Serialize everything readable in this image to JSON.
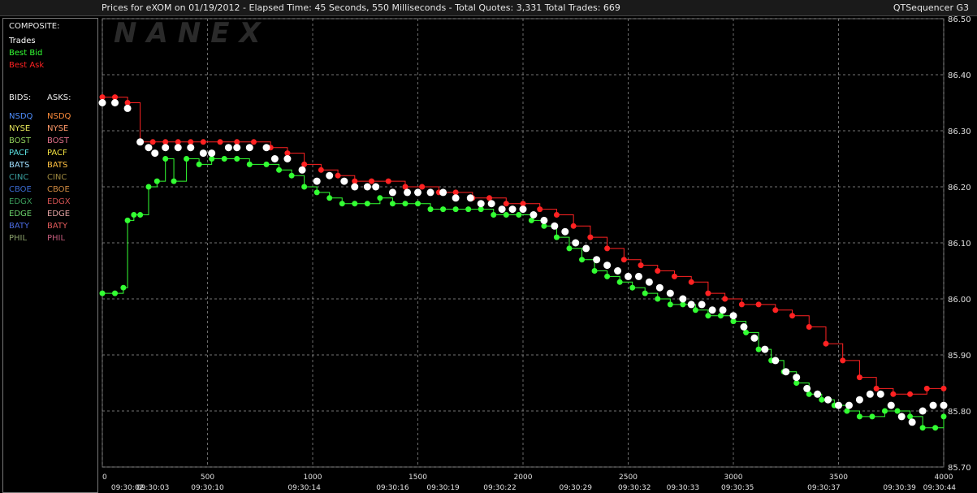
{
  "header": {
    "title": "Prices for  eXOM  on  01/19/2012  -  Elapsed Time: 45 Seconds, 550 Milliseconds  -  Total Quotes: 3,331  Total Trades: 669",
    "app_name": "QTSequencer G3"
  },
  "legend": {
    "composite_label": "COMPOSITE:",
    "composite_items": [
      {
        "label": "Trades",
        "color": "#ffffff"
      },
      {
        "label": "Best Bid",
        "color": "#33ff33"
      },
      {
        "label": "Best Ask",
        "color": "#ff2222"
      }
    ],
    "bids_label": "BIDS:",
    "asks_label": "ASKS:",
    "exchanges": [
      {
        "bid": "NSDQ",
        "bid_color": "#4f8fff",
        "ask": "NSDQ",
        "ask_color": "#ff8c3a"
      },
      {
        "bid": "NYSE",
        "bid_color": "#e8e85a",
        "ask": "NYSE",
        "ask_color": "#ff9a6a"
      },
      {
        "bid": "BOST",
        "bid_color": "#8fcf5a",
        "ask": "BOST",
        "ask_color": "#e0708a"
      },
      {
        "bid": "PACF",
        "bid_color": "#5ae0e0",
        "ask": "PACF",
        "ask_color": "#f0e040"
      },
      {
        "bid": "BATS",
        "bid_color": "#9fdfff",
        "ask": "BATS",
        "ask_color": "#ffc040"
      },
      {
        "bid": "CINC",
        "bid_color": "#3aa0a0",
        "ask": "CINC",
        "ask_color": "#a08a40"
      },
      {
        "bid": "CBOE",
        "bid_color": "#3a6ad0",
        "ask": "CBOE",
        "ask_color": "#d08a40"
      },
      {
        "bid": "EDGX",
        "bid_color": "#3a9a5a",
        "ask": "EDGX",
        "ask_color": "#d05050"
      },
      {
        "bid": "EDGE",
        "bid_color": "#6ad06a",
        "ask": "EDGE",
        "ask_color": "#e0a0a0"
      },
      {
        "bid": "BATY",
        "bid_color": "#4a6ae0",
        "ask": "BATY",
        "ask_color": "#e05a5a"
      },
      {
        "bid": "PHIL",
        "bid_color": "#8aa06a",
        "ask": "PHIL",
        "ask_color": "#c05a7a"
      }
    ]
  },
  "watermark": "NANEX",
  "chart_data": {
    "type": "line",
    "title": "",
    "xlabel": "",
    "ylabel": "",
    "ylim": [
      85.7,
      86.5
    ],
    "xlim": [
      0,
      4000
    ],
    "grid": true,
    "y_ticks": [
      "86.50",
      "86.40",
      "86.30",
      "86.20",
      "86.10",
      "86.00",
      "85.90",
      "85.80",
      "85.70"
    ],
    "y_tick_values": [
      86.5,
      86.4,
      86.3,
      86.2,
      86.1,
      86.0,
      85.9,
      85.8,
      85.7
    ],
    "x_ticks": [
      "0",
      "500",
      "1000",
      "1500",
      "2000",
      "2500",
      "3000",
      "3500",
      "4000"
    ],
    "x_tick_values": [
      0,
      500,
      1000,
      1500,
      2000,
      2500,
      3000,
      3500,
      4000
    ],
    "time_labels": [
      "09:30:02",
      "09:30:03",
      "09:30:10",
      "09:30:14",
      "09:30:16",
      "09:30:19",
      "09:30:22",
      "09:30:29",
      "09:30:32",
      "09:30:33",
      "09:30:35",
      "09:30:37",
      "09:30:39",
      "09:30:44"
    ],
    "time_label_x": [
      120,
      240,
      500,
      960,
      1380,
      1620,
      1890,
      2250,
      2530,
      2760,
      3020,
      3430,
      3790,
      3980
    ],
    "series": [
      {
        "name": "Trades",
        "color": "#ffffff",
        "x": [
          0,
          60,
          120,
          180,
          220,
          250,
          300,
          360,
          420,
          480,
          520,
          600,
          640,
          700,
          780,
          820,
          880,
          950,
          1020,
          1080,
          1150,
          1200,
          1260,
          1300,
          1380,
          1450,
          1500,
          1560,
          1620,
          1680,
          1750,
          1800,
          1850,
          1900,
          1950,
          2000,
          2050,
          2100,
          2150,
          2200,
          2250,
          2300,
          2350,
          2400,
          2450,
          2500,
          2550,
          2600,
          2650,
          2700,
          2760,
          2800,
          2850,
          2900,
          2950,
          3000,
          3050,
          3100,
          3150,
          3200,
          3250,
          3300,
          3350,
          3400,
          3450,
          3500,
          3550,
          3600,
          3650,
          3700,
          3750,
          3800,
          3850,
          3900,
          3950,
          4000
        ],
        "values": [
          86.35,
          86.35,
          86.34,
          86.28,
          86.27,
          86.26,
          86.27,
          86.27,
          86.27,
          86.26,
          86.26,
          86.27,
          86.27,
          86.27,
          86.27,
          86.25,
          86.25,
          86.23,
          86.21,
          86.22,
          86.21,
          86.2,
          86.2,
          86.2,
          86.19,
          86.19,
          86.19,
          86.19,
          86.19,
          86.18,
          86.18,
          86.17,
          86.17,
          86.16,
          86.16,
          86.16,
          86.15,
          86.14,
          86.13,
          86.12,
          86.1,
          86.09,
          86.07,
          86.06,
          86.05,
          86.04,
          86.04,
          86.03,
          86.02,
          86.01,
          86.0,
          85.99,
          85.99,
          85.98,
          85.98,
          85.97,
          85.95,
          85.93,
          85.91,
          85.89,
          85.87,
          85.86,
          85.84,
          85.83,
          85.82,
          85.81,
          85.81,
          85.82,
          85.83,
          85.83,
          85.81,
          85.79,
          85.78,
          85.8,
          85.81,
          85.81
        ]
      },
      {
        "name": "Best Bid",
        "color": "#33ff33",
        "x": [
          0,
          60,
          100,
          120,
          150,
          180,
          220,
          260,
          300,
          340,
          400,
          460,
          520,
          580,
          640,
          700,
          780,
          840,
          900,
          960,
          1020,
          1080,
          1140,
          1200,
          1260,
          1320,
          1380,
          1440,
          1500,
          1560,
          1620,
          1680,
          1740,
          1800,
          1860,
          1920,
          1980,
          2040,
          2100,
          2160,
          2220,
          2280,
          2340,
          2400,
          2460,
          2520,
          2580,
          2640,
          2700,
          2760,
          2820,
          2880,
          2940,
          3000,
          3060,
          3120,
          3180,
          3240,
          3300,
          3360,
          3420,
          3480,
          3540,
          3600,
          3660,
          3720,
          3780,
          3840,
          3900,
          3960,
          4000
        ],
        "values": [
          86.01,
          86.01,
          86.02,
          86.14,
          86.15,
          86.15,
          86.2,
          86.21,
          86.25,
          86.21,
          86.25,
          86.24,
          86.25,
          86.25,
          86.25,
          86.24,
          86.24,
          86.23,
          86.22,
          86.2,
          86.19,
          86.18,
          86.17,
          86.17,
          86.17,
          86.18,
          86.17,
          86.17,
          86.17,
          86.16,
          86.16,
          86.16,
          86.16,
          86.16,
          86.15,
          86.15,
          86.15,
          86.14,
          86.13,
          86.11,
          86.09,
          86.07,
          86.05,
          86.04,
          86.03,
          86.02,
          86.01,
          86.0,
          85.99,
          85.99,
          85.98,
          85.97,
          85.97,
          85.96,
          85.94,
          85.91,
          85.89,
          85.87,
          85.85,
          85.83,
          85.82,
          85.81,
          85.8,
          85.79,
          85.79,
          85.8,
          85.8,
          85.79,
          85.77,
          85.77,
          85.79
        ]
      },
      {
        "name": "Best Ask",
        "color": "#ff2222",
        "x": [
          0,
          60,
          120,
          180,
          240,
          300,
          360,
          420,
          480,
          560,
          640,
          720,
          800,
          880,
          960,
          1040,
          1120,
          1200,
          1280,
          1360,
          1440,
          1520,
          1600,
          1680,
          1760,
          1840,
          1920,
          2000,
          2080,
          2160,
          2240,
          2320,
          2400,
          2480,
          2560,
          2640,
          2720,
          2800,
          2880,
          2960,
          3040,
          3120,
          3200,
          3280,
          3360,
          3440,
          3520,
          3600,
          3680,
          3760,
          3840,
          3920,
          4000
        ],
        "values": [
          86.36,
          86.36,
          86.35,
          86.28,
          86.28,
          86.28,
          86.28,
          86.28,
          86.28,
          86.28,
          86.28,
          86.28,
          86.27,
          86.26,
          86.24,
          86.23,
          86.22,
          86.21,
          86.21,
          86.21,
          86.2,
          86.2,
          86.19,
          86.19,
          86.18,
          86.18,
          86.17,
          86.17,
          86.16,
          86.15,
          86.13,
          86.11,
          86.09,
          86.07,
          86.06,
          86.05,
          86.04,
          86.03,
          86.01,
          86.0,
          85.99,
          85.99,
          85.98,
          85.97,
          85.95,
          85.92,
          85.89,
          85.86,
          85.84,
          85.83,
          85.83,
          85.84,
          85.84
        ]
      }
    ]
  }
}
